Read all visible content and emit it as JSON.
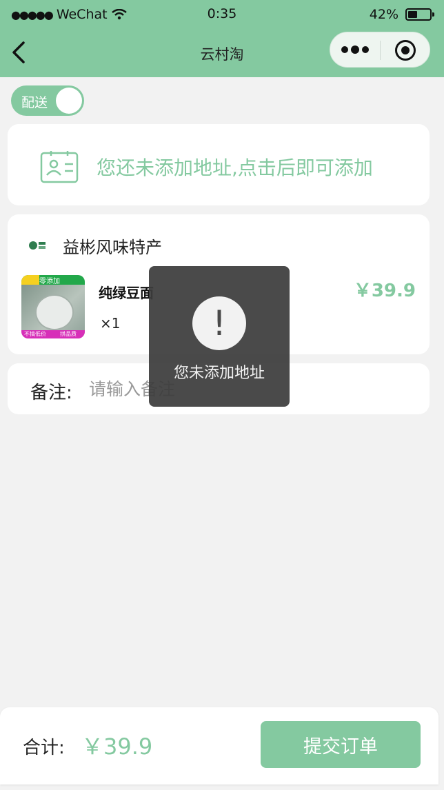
{
  "status_bar": {
    "carrier": "WeChat",
    "time": "0:35",
    "battery_percent": "42%",
    "battery_level": 0.42
  },
  "nav": {
    "title": "云村淘"
  },
  "delivery_toggle": {
    "label": "配送",
    "on": true
  },
  "address": {
    "placeholder": "您还未添加地址,点击后即可添加"
  },
  "shop": {
    "name": "益彬风味特产"
  },
  "goods": {
    "name": "纯绿豆面",
    "image_top_text": "零添加",
    "image_bottom_texts": [
      "不搞低价",
      "拼品质"
    ],
    "quantity": "×1",
    "price": "￥39.9"
  },
  "remark": {
    "label": "备注:",
    "placeholder": "请输入备注"
  },
  "toast": {
    "icon_text": "!",
    "message": "您未添加地址"
  },
  "footer": {
    "total_label": "合计:",
    "total_value": "￥39.9",
    "submit_label": "提交订单"
  },
  "colors": {
    "accent": "#84c9a0",
    "background": "#f2f2f2",
    "toast_bg": "#3c3c3c"
  }
}
